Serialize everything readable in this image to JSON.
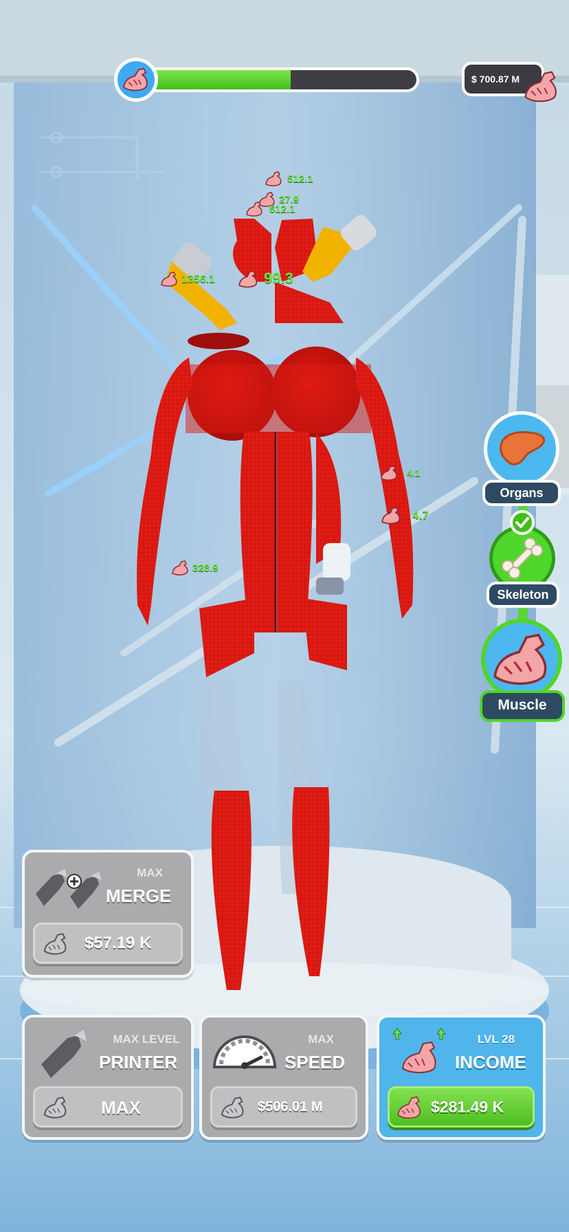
{
  "hud": {
    "progress_fraction": 0.55,
    "currency": "$ 700.87 M"
  },
  "floating_numbers": [
    "512.1",
    "27.9",
    "512.1",
    "1356.1",
    "99.3",
    "4.1",
    "4.7",
    "328.9"
  ],
  "categories": [
    {
      "label": "Organs",
      "icon": "liver-icon",
      "completed": false
    },
    {
      "label": "Skeleton",
      "icon": "bone-icon",
      "completed": true
    },
    {
      "label": "Muscle",
      "icon": "muscle-arm-icon",
      "selected": true
    }
  ],
  "upgrades": {
    "merge": {
      "level": "MAX",
      "title": "MERGE",
      "price": "$57.19 K",
      "icon": "merge-printers-icon"
    },
    "printer": {
      "level": "MAX LEVEL",
      "title": "PRINTER",
      "price": "MAX",
      "icon": "printer-nozzle-icon"
    },
    "speed": {
      "level": "MAX",
      "title": "SPEED",
      "price": "$506.01 M",
      "icon": "speedometer-icon"
    },
    "income": {
      "level": "LVL 28",
      "title": "INCOME",
      "price": "$281.49 K",
      "icon": "muscle-arm-upgrade-icon"
    }
  },
  "colors": {
    "progress": "#4fc61f",
    "muscle_red": "#d4140f",
    "income_card": "#4fb5ea",
    "category_label": "#2e4a63"
  }
}
